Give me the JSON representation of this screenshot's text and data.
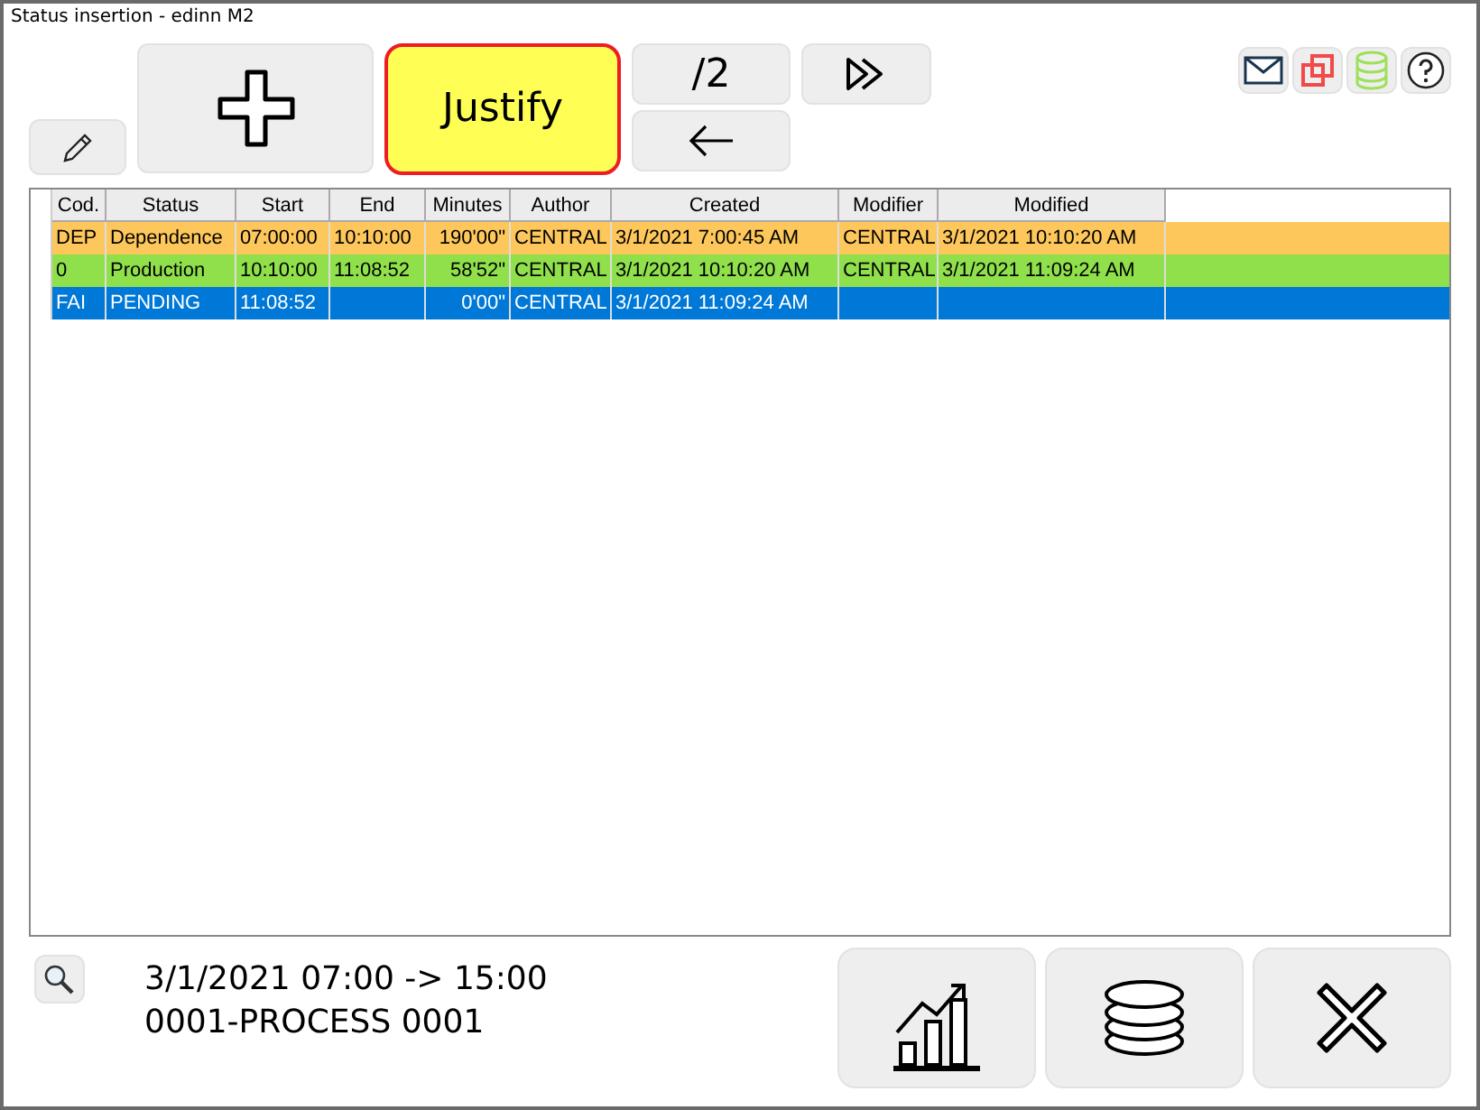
{
  "window": {
    "title": "Status insertion - edinn M2"
  },
  "toolbar": {
    "justify_label": "Justify",
    "page_label": "/2"
  },
  "table": {
    "columns": [
      "Cod.",
      "Status",
      "Start",
      "End",
      "Minutes",
      "Author",
      "Created",
      "Modifier",
      "Modified"
    ],
    "rows": [
      {
        "cells": [
          "DEP",
          "Dependence",
          "07:00:00",
          "10:10:00",
          "190'00\"",
          "CENTRAL",
          "3/1/2021 7:00:45 AM",
          "CENTRAL",
          "3/1/2021 10:10:20 AM"
        ],
        "color": "#fdc75b",
        "selected": false
      },
      {
        "cells": [
          "0",
          "Production",
          "10:10:00",
          "11:08:52",
          "58'52\"",
          "CENTRAL",
          "3/1/2021 10:10:20 AM",
          "CENTRAL",
          "3/1/2021 11:09:24 AM"
        ],
        "color": "#90e04c",
        "selected": false
      },
      {
        "cells": [
          "FAI",
          "PENDING",
          "11:08:52",
          "",
          "0'00\"",
          "CENTRAL",
          "3/1/2021 11:09:24 AM",
          "",
          ""
        ],
        "selected": true
      }
    ]
  },
  "footer": {
    "lines": [
      "3/1/2021 07:00 -> 15:00",
      "0001-PROCESS 0001"
    ]
  }
}
